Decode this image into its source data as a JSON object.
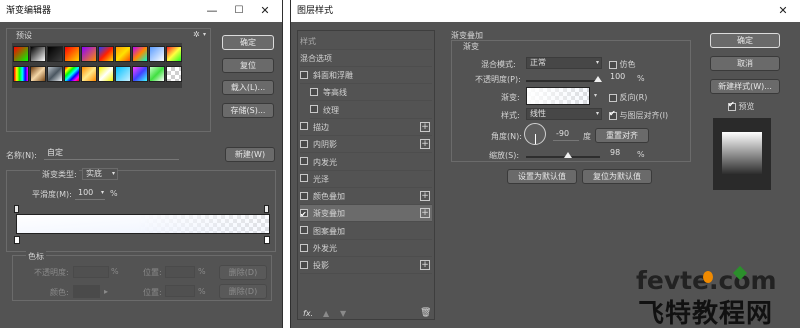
{
  "gradient_editor": {
    "title": "渐变编辑器",
    "presets_label": "预设",
    "gear": "✲",
    "buttons": {
      "ok": "确定",
      "reset": "复位",
      "load": "载入(L)...",
      "save": "存储(S)..."
    },
    "name_label": "名称(N):",
    "name_value": "自定",
    "new_button": "新建(W)",
    "type_label": "渐变类型:",
    "type_value": "实底",
    "smooth_label": "平滑度(M):",
    "smooth_value": "100",
    "percent": "%",
    "stops_group": "色标",
    "opacity_label": "不透明度:",
    "color_label": "颜色:",
    "location_label": "位置:",
    "delete_label": "删除(D)",
    "preset_swatches": [
      "linear-gradient(135deg,#ff0000,#00ff00)",
      "linear-gradient(135deg,#000000,#ffffff)",
      "linear-gradient(135deg,#000000,#ffffff00)",
      "linear-gradient(135deg,#ff0000,#ffd400)",
      "linear-gradient(135deg,#8a00ff,#ff9000)",
      "linear-gradient(135deg,#1f3fff,#ff2000,#ffe000)",
      "linear-gradient(135deg,#ff9a00,#ffe100,#ff4a00)",
      "linear-gradient(135deg,#b800ff,#ff8a00,#00ffd0)",
      "linear-gradient(135deg,#5a9cff,#ffffff)",
      "linear-gradient(135deg,#ff2020,#ffff40,#20ff20)",
      "linear-gradient(90deg,#ff0000,#ffff00,#00ff00,#00ffff,#0000ff,#ff00ff)",
      "linear-gradient(135deg,#6f3d10,#f5d7a8,#7a4a1a)",
      "linear-gradient(135deg,#b8c0c8,#4a5660,#eef2f6)",
      "linear-gradient(135deg,#f00,#ff0,#0f0,#0ff,#00f,#f0f,#f00)",
      "linear-gradient(135deg,#ff8a00,#ffe98a,#ff8a00)",
      "linear-gradient(135deg,#f5f500,#ffffff,#f5f500)",
      "linear-gradient(135deg,#00c0ff,#c8f0ff)",
      "linear-gradient(135deg,#ff40ff,#4040ff,#40ffff)",
      "linear-gradient(135deg,#c8ffc8,#40e040,#ffffff)",
      "checker"
    ]
  },
  "layer_style": {
    "title": "图层样式",
    "styles_header": "样式",
    "blend_options": "混合选项",
    "effects": [
      {
        "label": "斜面和浮雕",
        "checked": false,
        "plus": false,
        "indent": false
      },
      {
        "label": "等高线",
        "checked": false,
        "plus": false,
        "indent": true
      },
      {
        "label": "纹理",
        "checked": false,
        "plus": false,
        "indent": true
      },
      {
        "label": "描边",
        "checked": false,
        "plus": true,
        "indent": false
      },
      {
        "label": "内阴影",
        "checked": false,
        "plus": true,
        "indent": false
      },
      {
        "label": "内发光",
        "checked": false,
        "plus": false,
        "indent": false
      },
      {
        "label": "光泽",
        "checked": false,
        "plus": false,
        "indent": false
      },
      {
        "label": "颜色叠加",
        "checked": false,
        "plus": true,
        "indent": false
      },
      {
        "label": "渐变叠加",
        "checked": true,
        "plus": true,
        "indent": false
      },
      {
        "label": "图案叠加",
        "checked": false,
        "plus": false,
        "indent": false
      },
      {
        "label": "外发光",
        "checked": false,
        "plus": false,
        "indent": false
      },
      {
        "label": "投影",
        "checked": false,
        "plus": true,
        "indent": false
      }
    ],
    "fx": "fx.",
    "panel_title": "渐变叠加",
    "sub_title": "渐变",
    "blend_mode_label": "混合模式:",
    "blend_mode_value": "正常",
    "dither_label": "仿色",
    "opacity_label": "不透明度(P):",
    "opacity_value": "100",
    "gradient_label": "渐变:",
    "reverse_label": "反向(R)",
    "style_label": "样式:",
    "style_value": "线性",
    "align_label": "与图层对齐(I)",
    "angle_label": "角度(N):",
    "angle_value": "-90",
    "degree": "度",
    "reset_align": "重置对齐",
    "scale_label": "缩放(S):",
    "scale_value": "98",
    "percent": "%",
    "make_default": "设置为默认值",
    "reset_default": "复位为默认值",
    "buttons": {
      "ok": "确定",
      "cancel": "取消",
      "new_style": "新建样式(W)...",
      "preview": "预览"
    }
  },
  "watermark": {
    "brand": "fevte.com",
    "cn": "飞特教程网"
  },
  "colors": {
    "panel": "#535353",
    "accent_orange": "#f08a00",
    "accent_green": "#2b8f2b",
    "watermark_dark": "#222222"
  }
}
